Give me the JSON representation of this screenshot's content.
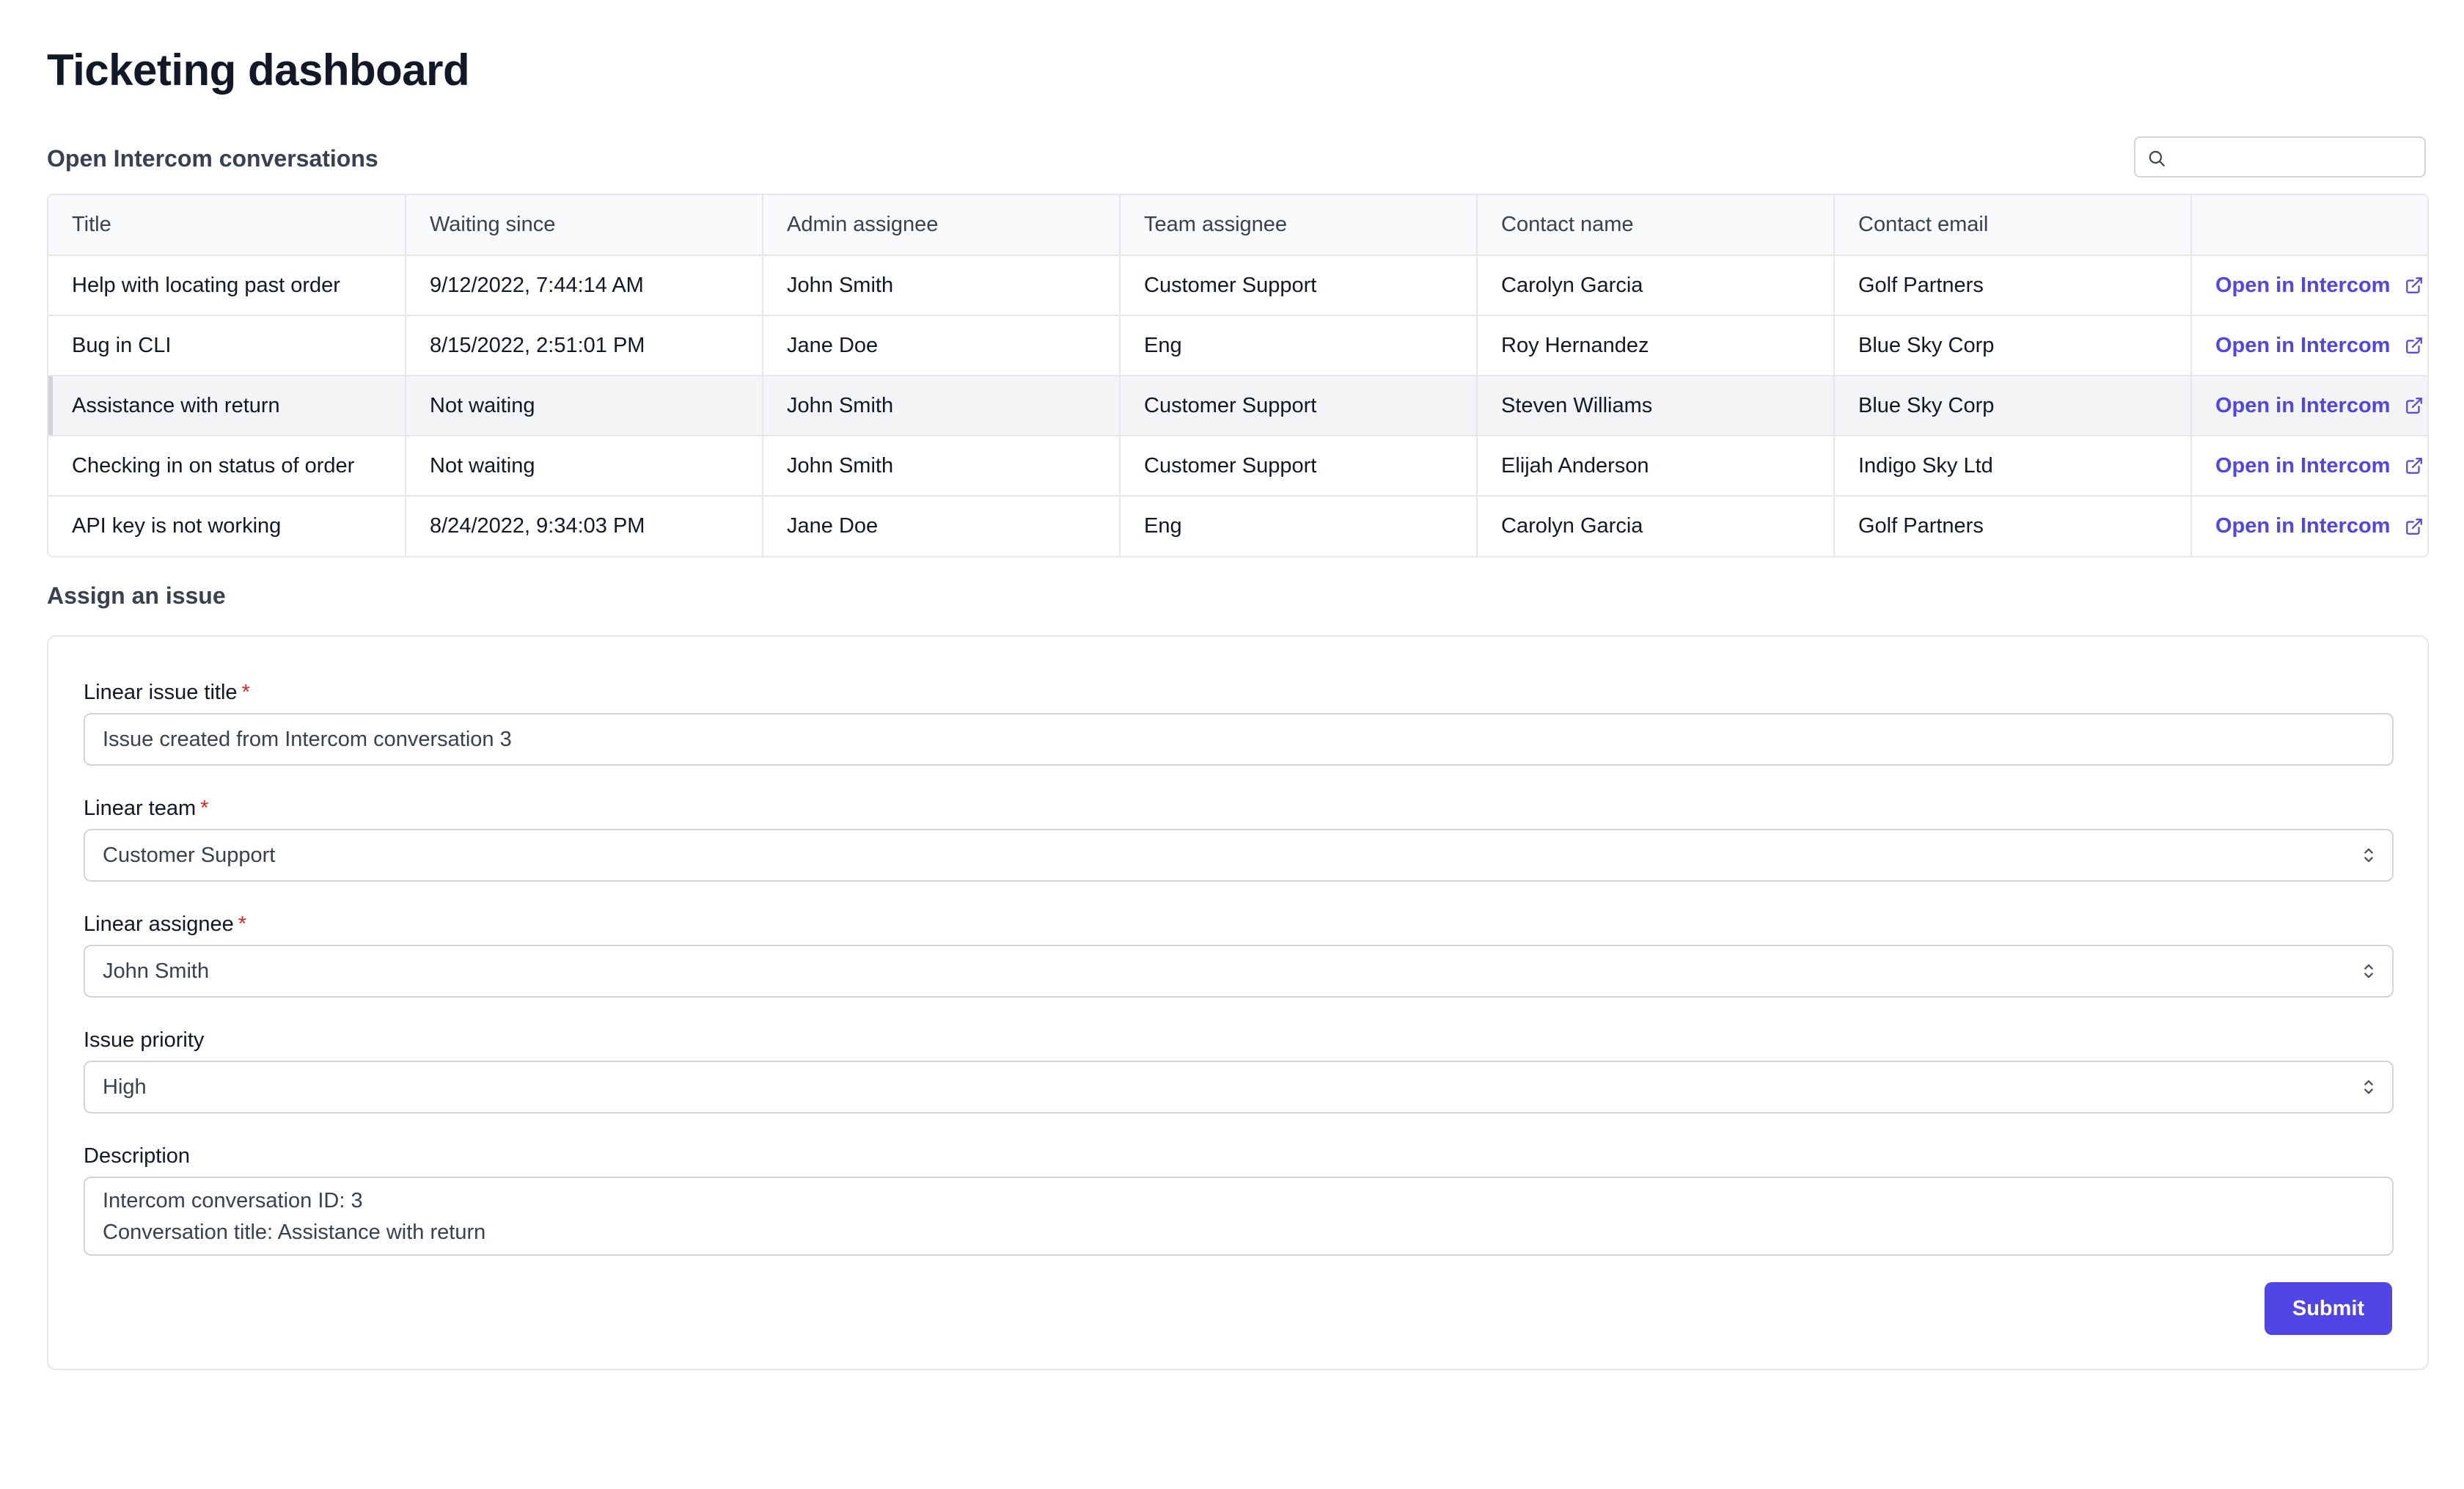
{
  "page": {
    "title": "Ticketing dashboard"
  },
  "conversations": {
    "section_title": "Open Intercom conversations",
    "search_placeholder": "",
    "columns": [
      "Title",
      "Waiting since",
      "Admin assignee",
      "Team assignee",
      "Contact name",
      "Contact email",
      ""
    ],
    "rows": [
      {
        "title": "Help with locating past order",
        "waiting_since": "9/12/2022, 7:44:14 AM",
        "admin_assignee": "John Smith",
        "team_assignee": "Customer Support",
        "contact_name": "Carolyn Garcia",
        "contact_email": "Golf Partners",
        "link_label": "Open in Intercom"
      },
      {
        "title": "Bug in CLI",
        "waiting_since": "8/15/2022, 2:51:01 PM",
        "admin_assignee": "Jane Doe",
        "team_assignee": "Eng",
        "contact_name": "Roy Hernandez",
        "contact_email": "Blue Sky Corp",
        "link_label": "Open in Intercom"
      },
      {
        "title": "Assistance with return",
        "waiting_since": "Not waiting",
        "admin_assignee": "John Smith",
        "team_assignee": "Customer Support",
        "contact_name": "Steven Williams",
        "contact_email": "Blue Sky Corp",
        "link_label": "Open in Intercom"
      },
      {
        "title": "Checking in on status of order",
        "waiting_since": "Not waiting",
        "admin_assignee": "John Smith",
        "team_assignee": "Customer Support",
        "contact_name": "Elijah Anderson",
        "contact_email": "Indigo Sky Ltd",
        "link_label": "Open in Intercom"
      },
      {
        "title": "API key is not working",
        "waiting_since": "8/24/2022, 9:34:03 PM",
        "admin_assignee": "Jane Doe",
        "team_assignee": "Eng",
        "contact_name": "Carolyn Garcia",
        "contact_email": "Golf Partners",
        "link_label": "Open in Intercom"
      }
    ],
    "selected_row": 2
  },
  "assign": {
    "section_title": "Assign an issue",
    "title_field": {
      "label": "Linear issue title",
      "required_mark": "*",
      "value": "Issue created from Intercom conversation 3"
    },
    "team_field": {
      "label": "Linear team",
      "required_mark": "*",
      "value": "Customer Support"
    },
    "assignee_field": {
      "label": "Linear assignee",
      "required_mark": "*",
      "value": "John Smith"
    },
    "priority_field": {
      "label": "Issue priority",
      "value": "High"
    },
    "description_field": {
      "label": "Description",
      "lines": [
        "Intercom conversation ID: 3",
        "Conversation title: Assistance with return"
      ]
    },
    "submit_label": "Submit"
  },
  "colors": {
    "accent": "#4f46e5",
    "required": "#dc2626",
    "border": "#e5e7eb",
    "selected_row_bg": "#f3f4f6"
  },
  "icons": {
    "search": "search-icon",
    "external_link": "external-link-icon",
    "select_arrows": "chevron-up-down-icon"
  }
}
